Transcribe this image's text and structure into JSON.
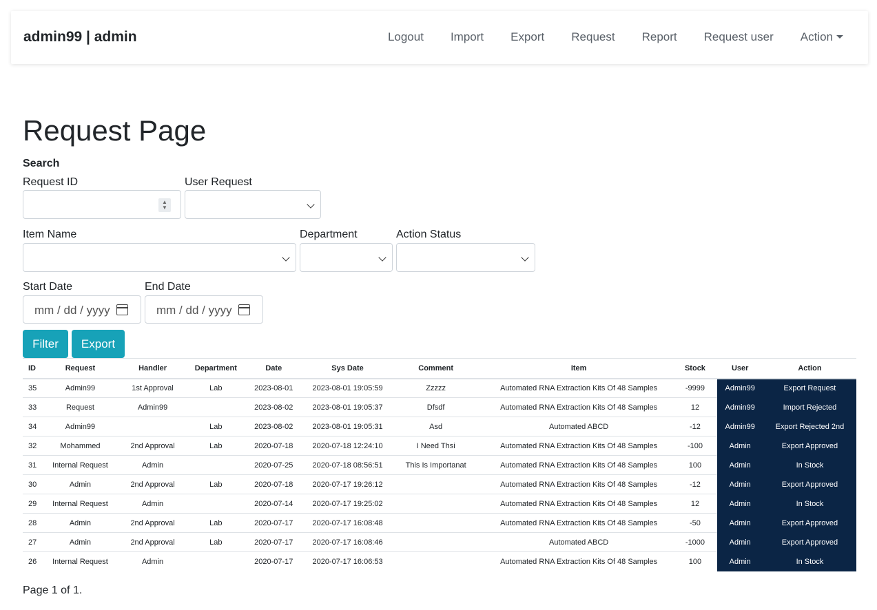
{
  "navbar": {
    "brand": "admin99 | admin",
    "links": [
      "Logout",
      "Import",
      "Export",
      "Request",
      "Report",
      "Request user"
    ],
    "action_label": "Action"
  },
  "page": {
    "title": "Request Page"
  },
  "search": {
    "heading": "Search",
    "request_id_label": "Request ID",
    "user_request_label": "User Request",
    "item_name_label": "Item Name",
    "department_label": "Department",
    "action_status_label": "Action Status",
    "start_date_label": "Start Date",
    "end_date_label": "End Date",
    "date_placeholder": "mm / dd / yyyy"
  },
  "buttons": {
    "filter": "Filter",
    "export": "Export"
  },
  "table": {
    "headers": [
      "ID",
      "Request",
      "Handler",
      "Department",
      "Date",
      "Sys Date",
      "Comment",
      "Item",
      "Stock",
      "User",
      "Action"
    ],
    "rows": [
      [
        "35",
        "Admin99",
        "1st Approval",
        "Lab",
        "2023-08-01",
        "2023-08-01 19:05:59",
        "Zzzzz",
        "Automated RNA Extraction Kits Of 48 Samples",
        "-9999",
        "Admin99",
        "Export Request"
      ],
      [
        "33",
        "Request",
        "Admin99",
        "",
        "2023-08-02",
        "2023-08-01 19:05:37",
        "Dfsdf",
        "Automated RNA Extraction Kits Of 48 Samples",
        "12",
        "Admin99",
        "Import Rejected"
      ],
      [
        "34",
        "Admin99",
        "",
        "Lab",
        "2023-08-02",
        "2023-08-01 19:05:31",
        "Asd",
        "Automated ABCD",
        "-12",
        "Admin99",
        "Export Rejected 2nd"
      ],
      [
        "32",
        "Mohammed",
        "2nd Approval",
        "Lab",
        "2020-07-18",
        "2020-07-18 12:24:10",
        "I Need Thsi",
        "Automated RNA Extraction Kits Of 48 Samples",
        "-100",
        "Admin",
        "Export Approved"
      ],
      [
        "31",
        "Internal Request",
        "Admin",
        "",
        "2020-07-25",
        "2020-07-18 08:56:51",
        "This Is Importanat",
        "Automated RNA Extraction Kits Of 48 Samples",
        "100",
        "Admin",
        "In Stock"
      ],
      [
        "30",
        "Admin",
        "2nd Approval",
        "Lab",
        "2020-07-18",
        "2020-07-17 19:26:12",
        "",
        "Automated RNA Extraction Kits Of 48 Samples",
        "-12",
        "Admin",
        "Export Approved"
      ],
      [
        "29",
        "Internal Request",
        "Admin",
        "",
        "2020-07-14",
        "2020-07-17 19:25:02",
        "",
        "Automated RNA Extraction Kits Of 48 Samples",
        "12",
        "Admin",
        "In Stock"
      ],
      [
        "28",
        "Admin",
        "2nd Approval",
        "Lab",
        "2020-07-17",
        "2020-07-17 16:08:48",
        "",
        "Automated RNA Extraction Kits Of 48 Samples",
        "-50",
        "Admin",
        "Export Approved"
      ],
      [
        "27",
        "Admin",
        "2nd Approval",
        "Lab",
        "2020-07-17",
        "2020-07-17 16:08:46",
        "",
        "Automated ABCD",
        "-1000",
        "Admin",
        "Export Approved"
      ],
      [
        "26",
        "Internal Request",
        "Admin",
        "",
        "2020-07-17",
        "2020-07-17 16:06:53",
        "",
        "Automated RNA Extraction Kits Of 48 Samples",
        "100",
        "Admin",
        "In Stock"
      ]
    ]
  },
  "pagination": {
    "text": "Page 1 of 1."
  },
  "colors": {
    "accent": "#17a2b8",
    "user_action_bg": "#0b2545"
  }
}
